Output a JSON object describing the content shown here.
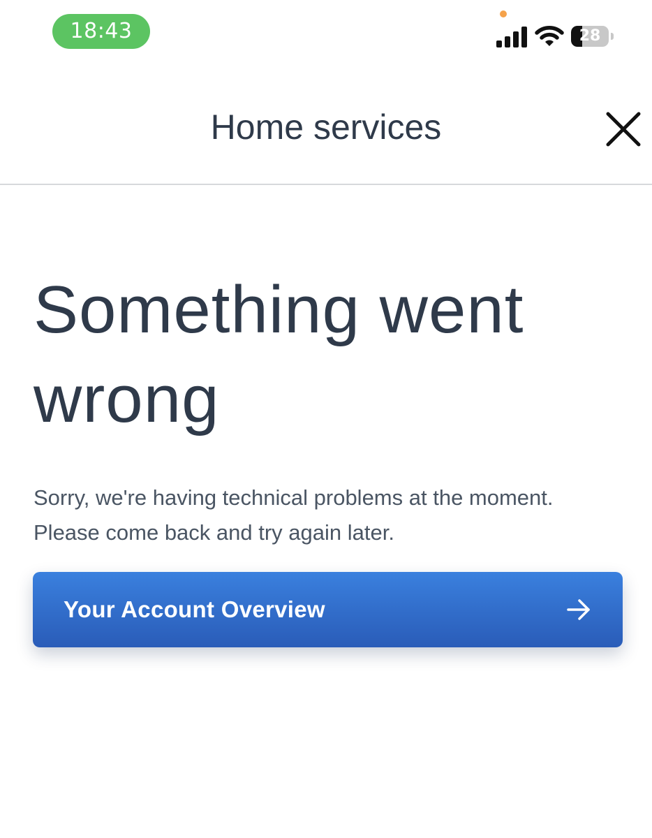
{
  "status_bar": {
    "time": "18:43",
    "battery_level": "28",
    "icons": [
      "signal-icon",
      "wifi-icon",
      "battery-icon"
    ],
    "colors": {
      "time_pill": "#5cc462",
      "privacy_dot": "#f5a24a"
    }
  },
  "header": {
    "title": "Home services",
    "close_icon": "close-icon"
  },
  "main": {
    "heading": "Something went wrong",
    "message_line_1": "Sorry, we're having technical problems at the moment.",
    "message_line_2": "Please come back and try again later."
  },
  "actions": {
    "account_overview_label": "Your Account Overview",
    "arrow_icon": "arrow-right-icon"
  },
  "colors": {
    "text": "#2f3a4a",
    "button_top": "#3a80de",
    "button_bottom": "#2a5cb8",
    "divider": "#d6d8db"
  }
}
